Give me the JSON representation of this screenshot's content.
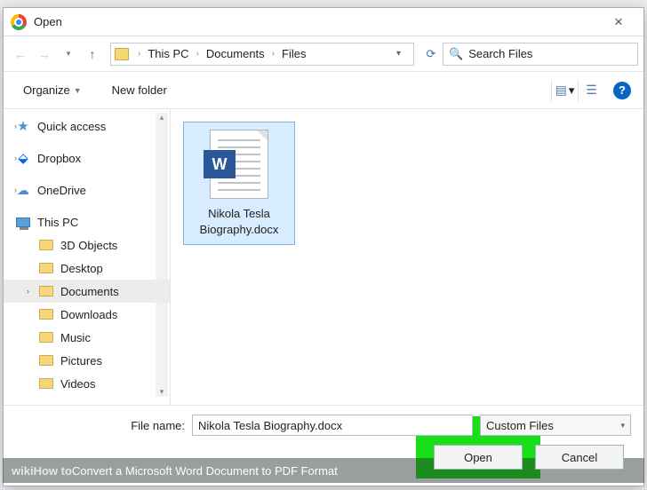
{
  "window": {
    "title": "Open"
  },
  "breadcrumbs": {
    "root": "This PC",
    "a": "Documents",
    "b": "Files"
  },
  "search": {
    "placeholder": "Search Files"
  },
  "toolbar": {
    "organize": "Organize",
    "newfolder": "New folder"
  },
  "sidebar": {
    "quick": "Quick access",
    "dropbox": "Dropbox",
    "onedrive": "OneDrive",
    "thispc": "This PC",
    "children": [
      "3D Objects",
      "Desktop",
      "Documents",
      "Downloads",
      "Music",
      "Pictures",
      "Videos"
    ]
  },
  "file": {
    "name": "Nikola Tesla Biography.docx",
    "badge": "W"
  },
  "footer": {
    "label": "File name:",
    "value": "Nikola Tesla Biography.docx",
    "filter": "Custom Files",
    "open": "Open",
    "cancel": "Cancel"
  },
  "caption": {
    "prefix": "wikiHow to ",
    "text": "Convert a Microsoft Word Document to PDF Format"
  }
}
